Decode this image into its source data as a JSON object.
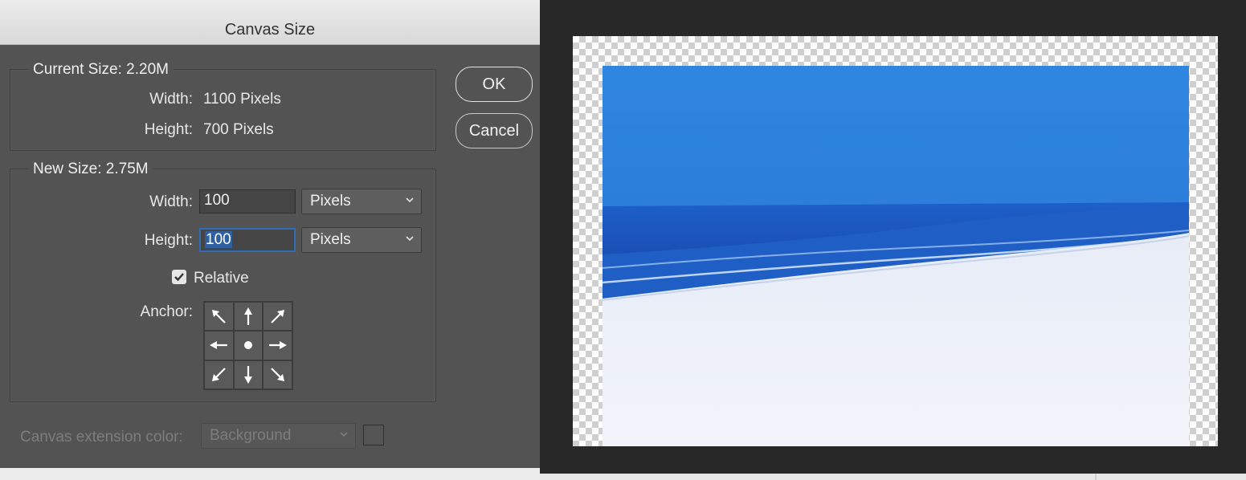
{
  "dialog": {
    "title": "Canvas Size",
    "current_size": {
      "legend": "Current Size: 2.20M",
      "width_label": "Width:",
      "width_value": "1100 Pixels",
      "height_label": "Height:",
      "height_value": "700 Pixels"
    },
    "new_size": {
      "legend": "New Size: 2.75M",
      "width_label": "Width:",
      "width_value": "100",
      "width_unit": "Pixels",
      "height_label": "Height:",
      "height_value": "100",
      "height_unit": "Pixels",
      "relative_label": "Relative",
      "relative_checked": true,
      "anchor_label": "Anchor:",
      "anchor_grid": [
        "arrow-up-left-icon",
        "arrow-up-icon",
        "arrow-up-right-icon",
        "arrow-left-icon",
        "center-dot-icon",
        "arrow-right-icon",
        "arrow-down-left-icon",
        "arrow-down-icon",
        "arrow-down-right-icon"
      ]
    },
    "extension": {
      "label": "Canvas extension color:",
      "value": "Background"
    },
    "buttons": {
      "ok": "OK",
      "cancel": "Cancel"
    }
  },
  "colors": {
    "panel": "#535353",
    "canvas_bg": "#282828",
    "focus": "#2f6db8",
    "sea": "#2f86e0",
    "sand": "#eef2fb"
  }
}
